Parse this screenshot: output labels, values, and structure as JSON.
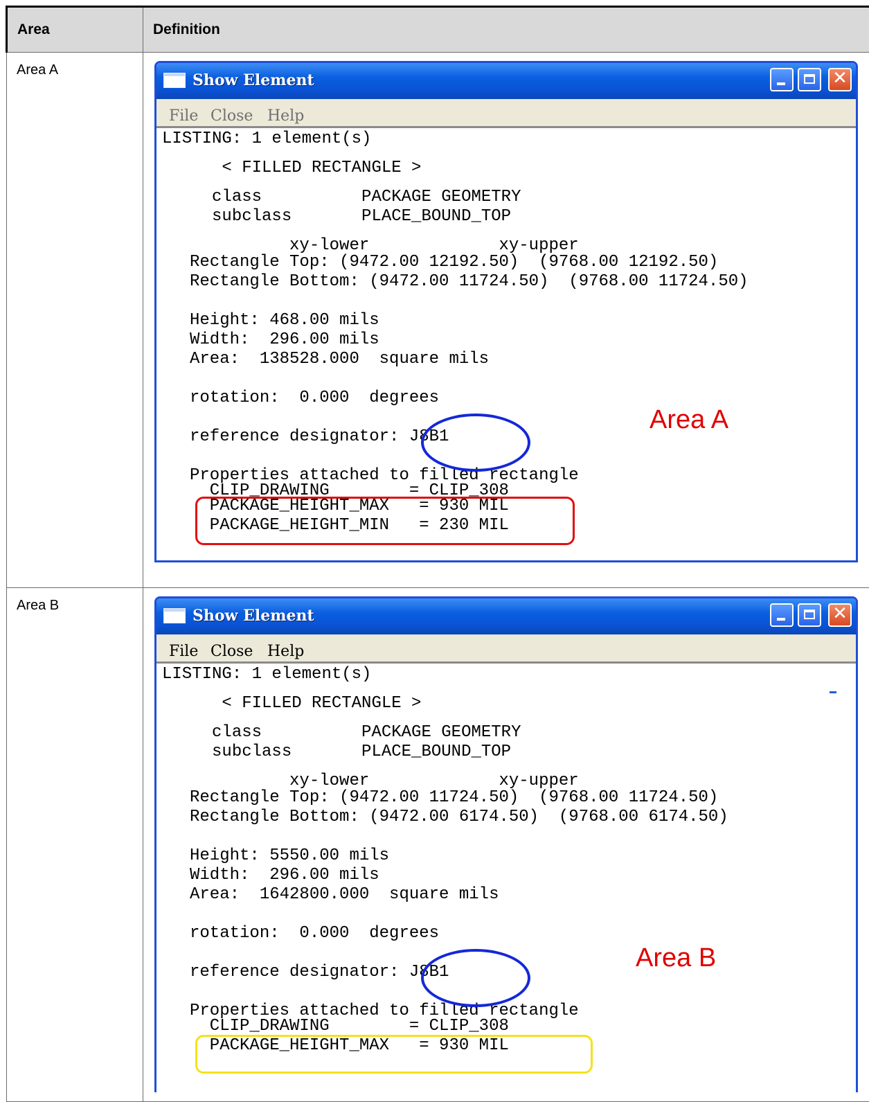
{
  "table": {
    "header": {
      "area": "Area",
      "definition": "Definition"
    },
    "rows": [
      {
        "area": "Area A",
        "window": {
          "title": "Show Element",
          "menu": [
            "File",
            "Close",
            "Help"
          ],
          "close_glyph": "✕",
          "lines": [
            "LISTING: 1 element(s)",
            "      < FILLED RECTANGLE >",
            "     class          PACKAGE GEOMETRY",
            "     subclass       PLACE_BOUND_TOP",
            "          xy-lower             xy-upper",
            "Rectangle Top: (9472.00 12192.50)  (9768.00 12192.50)",
            "Rectangle Bottom: (9472.00 11724.50)  (9768.00 11724.50)",
            "Height: 468.00 mils",
            "Width:  296.00 mils",
            "Area:  138528.000  square mils",
            "rotation:  0.000  degrees",
            "reference designator: J8B1",
            "Properties attached to filled rectangle",
            "  CLIP_DRAWING        = CLIP_308",
            "  PACKAGE_HEIGHT_MAX   = 930 MIL",
            "  PACKAGE_HEIGHT_MIN   = 230 MIL"
          ],
          "annotation": "Area A"
        }
      },
      {
        "area": "Area B",
        "window": {
          "title": "Show Element",
          "menu": [
            "File",
            "Close",
            "Help"
          ],
          "close_glyph": "✕",
          "lines": [
            "LISTING: 1 element(s)",
            "      < FILLED RECTANGLE >",
            "     class          PACKAGE GEOMETRY",
            "     subclass       PLACE_BOUND_TOP",
            "          xy-lower             xy-upper",
            "Rectangle Top: (9472.00 11724.50)  (9768.00 11724.50)",
            "Rectangle Bottom: (9472.00 6174.50)  (9768.00 6174.50)",
            "Height: 5550.00 mils",
            "Width:  296.00 mils",
            "Area:  1642800.000  square mils",
            "rotation:  0.000  degrees",
            "reference designator: J8B1",
            "Properties attached to filled rectangle",
            "  CLIP_DRAWING        = CLIP_308",
            "  PACKAGE_HEIGHT_MAX   = 930 MIL"
          ],
          "annotation": "Area B"
        }
      }
    ]
  }
}
